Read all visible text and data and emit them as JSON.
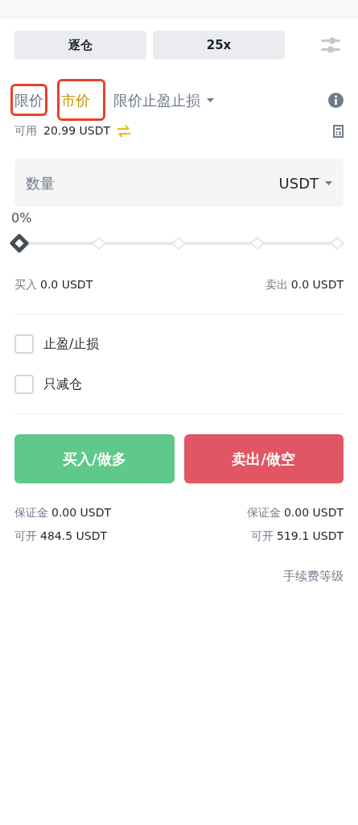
{
  "margin_mode": {
    "label": "逐仓"
  },
  "leverage": {
    "label": "25x"
  },
  "order_types": [
    {
      "kind": "tab",
      "label": "限价",
      "selected": false,
      "annotated": true
    },
    {
      "kind": "tab",
      "label": "市价",
      "selected": true,
      "annotated": true
    },
    {
      "kind": "dropdown",
      "label": "限价止盈止损",
      "selected": false,
      "annotated": false
    }
  ],
  "available": {
    "label": "可用",
    "value": "20.99 USDT"
  },
  "quantity": {
    "placeholder": "数量",
    "unit": "USDT"
  },
  "slider": {
    "reading": "0%",
    "level": 0
  },
  "buy_amount": {
    "label": "买入",
    "value": "0.0 USDT"
  },
  "sell_amount": {
    "label": "卖出",
    "value": "0.0 USDT"
  },
  "options": [
    {
      "label": "止盈/止损",
      "checked": false
    },
    {
      "label": "只减仓",
      "checked": false
    }
  ],
  "buttons": [
    {
      "kind": "buy",
      "label": "买入/做多"
    },
    {
      "kind": "sell",
      "label": "卖出/做空"
    }
  ],
  "stats": [
    {
      "margin_label": "保证金",
      "margin": "0.00 USDT",
      "open_label": "可开",
      "open": "484.5 USDT"
    },
    {
      "margin_label": "保证金",
      "margin": "0.00 USDT",
      "open_label": "可开",
      "open": "519.1 USDT"
    }
  ],
  "fee_link": "手续费等级"
}
